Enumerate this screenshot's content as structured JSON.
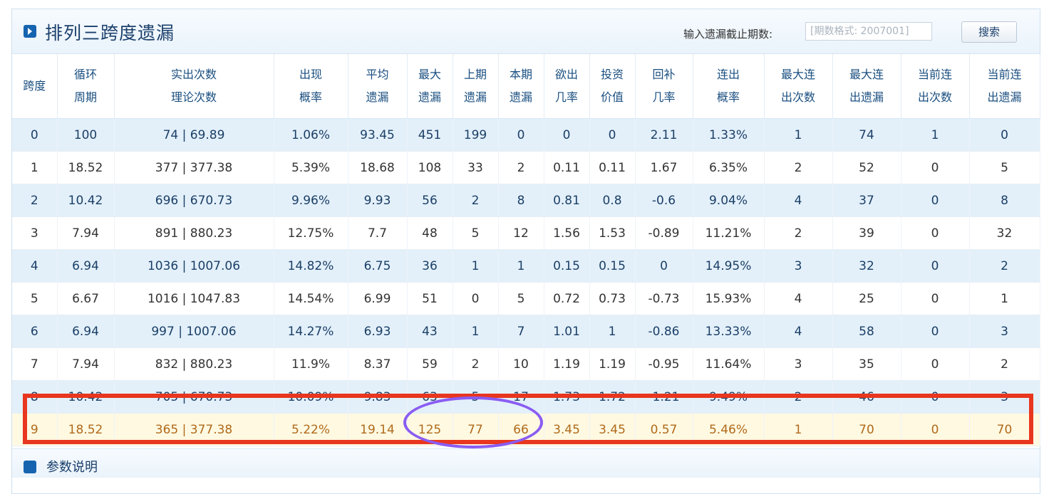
{
  "header": {
    "title": "排列三跨度遗漏",
    "search_label": "输入遗漏截止期数:",
    "search_placeholder": "[期数格式: 2007001]",
    "search_button": "搜索"
  },
  "columns": [
    {
      "l1": "跨度",
      "l2": ""
    },
    {
      "l1": "循环",
      "l2": "周期"
    },
    {
      "l1": "实出次数",
      "l2": "理论次数"
    },
    {
      "l1": "出现",
      "l2": "概率"
    },
    {
      "l1": "平均",
      "l2": "遗漏"
    },
    {
      "l1": "最大",
      "l2": "遗漏"
    },
    {
      "l1": "上期",
      "l2": "遗漏"
    },
    {
      "l1": "本期",
      "l2": "遗漏"
    },
    {
      "l1": "欲出",
      "l2": "几率"
    },
    {
      "l1": "投资",
      "l2": "价值"
    },
    {
      "l1": "回补",
      "l2": "几率"
    },
    {
      "l1": "连出",
      "l2": "概率"
    },
    {
      "l1": "最大连",
      "l2": "出次数"
    },
    {
      "l1": "最大连",
      "l2": "出遗漏"
    },
    {
      "l1": "当前连",
      "l2": "出次数"
    },
    {
      "l1": "当前连",
      "l2": "出遗漏"
    }
  ],
  "rows": [
    [
      "0",
      "100",
      "74 | 69.89",
      "1.06%",
      "93.45",
      "451",
      "199",
      "0",
      "0",
      "0",
      "2.11",
      "1.33%",
      "1",
      "74",
      "1",
      "0"
    ],
    [
      "1",
      "18.52",
      "377 | 377.38",
      "5.39%",
      "18.68",
      "108",
      "33",
      "2",
      "0.11",
      "0.11",
      "1.67",
      "6.35%",
      "2",
      "52",
      "0",
      "5"
    ],
    [
      "2",
      "10.42",
      "696 | 670.73",
      "9.96%",
      "9.93",
      "56",
      "2",
      "8",
      "0.81",
      "0.8",
      "-0.6",
      "9.04%",
      "4",
      "37",
      "0",
      "8"
    ],
    [
      "3",
      "7.94",
      "891 | 880.23",
      "12.75%",
      "7.7",
      "48",
      "5",
      "12",
      "1.56",
      "1.53",
      "-0.89",
      "11.21%",
      "2",
      "39",
      "0",
      "32"
    ],
    [
      "4",
      "6.94",
      "1036 | 1007.06",
      "14.82%",
      "6.75",
      "36",
      "1",
      "1",
      "0.15",
      "0.15",
      "0",
      "14.95%",
      "3",
      "32",
      "0",
      "2"
    ],
    [
      "5",
      "6.67",
      "1016 | 1047.83",
      "14.54%",
      "6.99",
      "51",
      "0",
      "5",
      "0.72",
      "0.73",
      "-0.73",
      "15.93%",
      "4",
      "25",
      "0",
      "1"
    ],
    [
      "6",
      "6.94",
      "997 | 1007.06",
      "14.27%",
      "6.93",
      "43",
      "1",
      "7",
      "1.01",
      "1",
      "-0.86",
      "13.33%",
      "4",
      "58",
      "0",
      "3"
    ],
    [
      "7",
      "7.94",
      "832 | 880.23",
      "11.9%",
      "8.37",
      "59",
      "2",
      "10",
      "1.19",
      "1.19",
      "-0.95",
      "11.64%",
      "3",
      "35",
      "0",
      "2"
    ],
    [
      "8",
      "10.42",
      "705 | 670.73",
      "10.09%",
      "9.83",
      "63",
      "5",
      "17",
      "1.73",
      "1.72",
      "-1.21",
      "9.49%",
      "2",
      "46",
      "0",
      "3"
    ],
    [
      "9",
      "18.52",
      "365 | 377.38",
      "5.22%",
      "19.14",
      "125",
      "77",
      "66",
      "3.45",
      "3.45",
      "0.57",
      "5.46%",
      "1",
      "70",
      "0",
      "70"
    ]
  ],
  "footer": {
    "section_label": "参数说明"
  },
  "colors": {
    "highlight_row_bg": "#fff9e2",
    "annotation_box": "#e8361f",
    "annotation_ellipse": "#8a5cf2"
  }
}
